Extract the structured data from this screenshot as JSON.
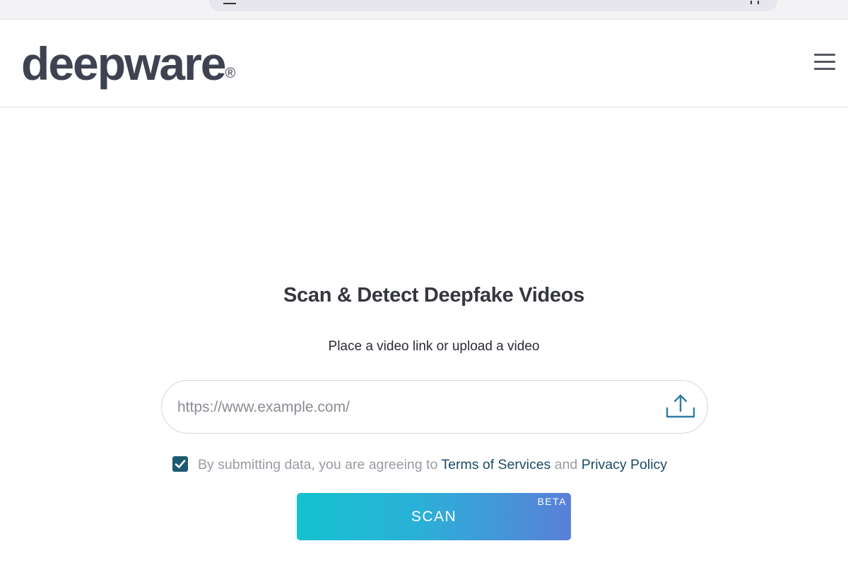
{
  "browser": {
    "left_icon": "lock-icon",
    "right_icon": "reader-icon"
  },
  "header": {
    "logo_text": "deepware",
    "logo_mark": "®",
    "menu_icon": "hamburger-menu-icon"
  },
  "main": {
    "title": "Scan & Detect Deepfake Videos",
    "subtitle": "Place a video link or upload a video",
    "url_input": {
      "placeholder": "https://www.example.com/",
      "value": ""
    },
    "upload_icon": "upload-icon",
    "terms": {
      "checked": true,
      "prefix": "By submitting data, you are agreeing to ",
      "terms_link": "Terms of Services",
      "conjunction": " and ",
      "privacy_link": "Privacy Policy"
    },
    "scan_button": {
      "label": "SCAN",
      "badge": "BETA"
    }
  },
  "colors": {
    "logo": "#3f4250",
    "link": "#1c4a63",
    "checkbox": "#1d5a72",
    "scan_gradient_start": "#14c2cf",
    "scan_gradient_end": "#5a7fd8",
    "upload_icon": "#2c7ba6"
  }
}
